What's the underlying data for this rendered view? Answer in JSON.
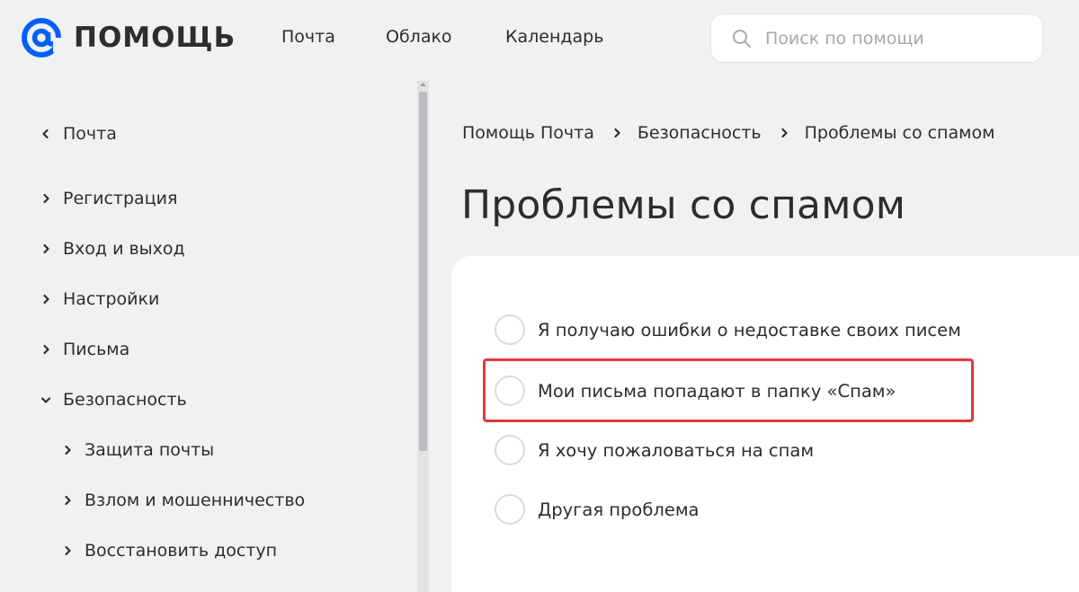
{
  "header": {
    "logo_text": "ПОМОЩЬ",
    "nav": [
      "Почта",
      "Облако",
      "Календарь"
    ],
    "search_placeholder": "Поиск по помощи"
  },
  "sidebar": {
    "back_label": "Почта",
    "items": [
      {
        "label": "Регистрация",
        "expanded": false
      },
      {
        "label": "Вход и выход",
        "expanded": false
      },
      {
        "label": "Настройки",
        "expanded": false
      },
      {
        "label": "Письма",
        "expanded": false
      },
      {
        "label": "Безопасность",
        "expanded": true
      }
    ],
    "subitems": [
      "Защита почты",
      "Взлом и мошенничество",
      "Восстановить доступ"
    ]
  },
  "breadcrumb": [
    "Помощь Почта",
    "Безопасность",
    "Проблемы со спамом"
  ],
  "page_title": "Проблемы со спамом",
  "options": [
    "Я получаю ошибки о недоставке своих писем",
    "Мои письма попадают в папку «Спам»",
    "Я хочу пожаловаться на спам",
    "Другая проблема"
  ],
  "colors": {
    "brand": "#005ff9",
    "highlight": "#e0393e",
    "background": "#f0f1f3"
  }
}
